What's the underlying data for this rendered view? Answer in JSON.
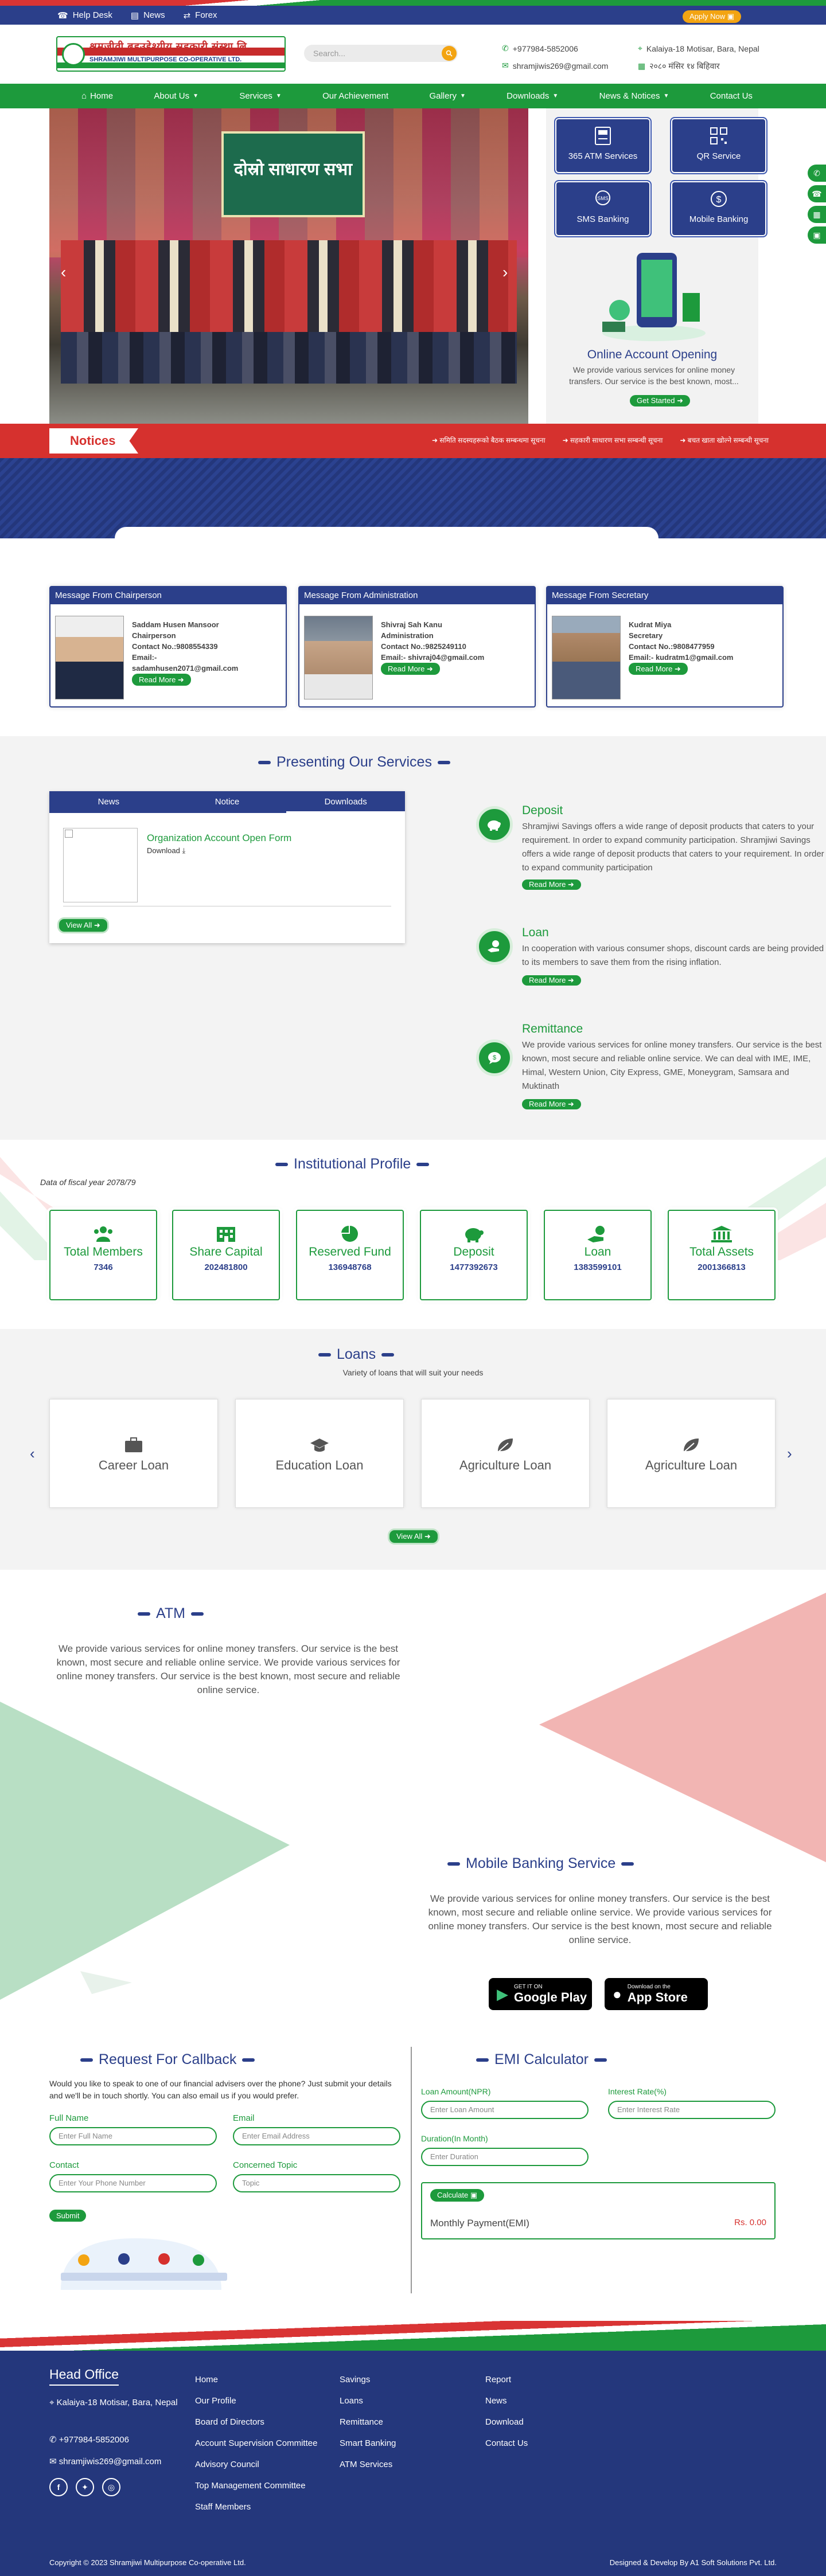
{
  "topbar": {
    "links": [
      "Help Desk",
      "News",
      "Forex"
    ],
    "apply": "Apply Now"
  },
  "header": {
    "logo_name": "श्रमजीवी बहुउद्देश्यीय सहकारी संस्था लि.",
    "logo_sub": "SHRAMJIWI MULTIPURPOSE CO-OPERATIVE LTD.",
    "search_placeholder": "Search...",
    "phone": "+977984-5852006",
    "address": "Kalaiya-18 Motisar, Bara, Nepal",
    "email": "shramjiwis269@gmail.com",
    "reg": "२०८० मंसिर १४ बिहिवार"
  },
  "nav": [
    {
      "label": "Home"
    },
    {
      "label": "About Us",
      "dd": true
    },
    {
      "label": "Services",
      "dd": true
    },
    {
      "label": "Our Achievement"
    },
    {
      "label": "Gallery",
      "dd": true
    },
    {
      "label": "Downloads",
      "dd": true
    },
    {
      "label": "News & Notices",
      "dd": true
    },
    {
      "label": "Contact Us"
    }
  ],
  "hero": {
    "banner_text": "दोस्रो साधारण सभा",
    "tiles": [
      "365 ATM Services",
      "QR Service",
      "SMS Banking",
      "Mobile Banking"
    ],
    "promo_title": "Online Account Opening",
    "promo_text": "We provide various services for online money transfers. Our service is the best known, most...",
    "promo_btn": "Get Started"
  },
  "notices": {
    "label": "Notices",
    "items": [
      "समिति सदस्यहरूको बैठक सम्बन्धमा सूचना",
      "सहकारी साधारण सभा सम्बन्धी सूचना",
      "बचत खाता खोल्ने सम्बन्धी सूचना"
    ]
  },
  "messages": [
    {
      "title": "Message From Chairperson",
      "name": "Saddam Husen Mansoor",
      "role": "Chairperson",
      "contact": "Contact No.:9808554339",
      "email_label": "Email:-",
      "email": "sadamhusen2071@gmail.com",
      "btn": "Read More"
    },
    {
      "title": "Message From Administration",
      "name": "Shivraj Sah Kanu",
      "role": "Administration",
      "contact": "Contact No.:9825249110",
      "email_label": "Email:- shivraj04@gmail.com",
      "email": "",
      "btn": "Read More"
    },
    {
      "title": "Message From Secretary",
      "name": "Kudrat Miya",
      "role": "Secretary",
      "contact": "Contact No.:9808477959",
      "email_label": "Email:- kudratm1@gmail.com",
      "email": "",
      "btn": "Read More"
    }
  ],
  "services": {
    "title": "Presenting Our Services",
    "tabs": [
      "News",
      "Notice",
      "Downloads"
    ],
    "download_title": "Organization Account Open Form",
    "download_label": "Download",
    "view_all": "View All",
    "items": [
      {
        "title": "Deposit",
        "text": "Shramjiwi Savings offers a wide range of deposit products that caters to your requirement. In order to expand community participation. Shramjiwi Savings offers a wide range of deposit products that caters to your requirement. In order to expand community participation",
        "btn": "Read More"
      },
      {
        "title": "Loan",
        "text": "In cooperation with various consumer shops, discount cards are being provided to its members to save them from the rising inflation.",
        "btn": "Read More"
      },
      {
        "title": "Remittance",
        "text": "We provide various services for online money transfers. Our service is the best known, most secure and reliable online service. We can deal with IME, IME, Himal, Western Union, City Express, GME, Moneygram, Samsara and Muktinath",
        "btn": "Read More"
      }
    ]
  },
  "profile": {
    "title": "Institutional Profile",
    "fiscal": "Data of fiscal year 2078/79",
    "stats": [
      {
        "label": "Total Members",
        "value": "7346",
        "icon": "users-icon"
      },
      {
        "label": "Share Capital",
        "value": "202481800",
        "icon": "building-icon"
      },
      {
        "label": "Reserved Fund",
        "value": "136948768",
        "icon": "pie-chart-icon"
      },
      {
        "label": "Deposit",
        "value": "1477392673",
        "icon": "piggy-bank-icon"
      },
      {
        "label": "Loan",
        "value": "1383599101",
        "icon": "hand-holding-usd-icon"
      },
      {
        "label": "Total Assets",
        "value": "2001366813",
        "icon": "bank-icon"
      }
    ]
  },
  "loans": {
    "title": "Loans",
    "subtitle": "Variety of loans that will suit your needs",
    "items": [
      "Career Loan",
      "Education Loan",
      "Agriculture Loan",
      "Agriculture Loan"
    ],
    "view_all": "View All"
  },
  "atm": {
    "title": "ATM",
    "text": "We provide various services for online money transfers. Our service is the best known, most secure and reliable online service. We provide various services for online money transfers. Our service is the best known, most secure and reliable online service."
  },
  "mobile": {
    "title": "Mobile Banking Service",
    "text": "We provide various services for online money transfers. Our service is the best known, most secure and reliable online service. We provide various services for online money transfers. Our service is the best known, most secure and reliable online service.",
    "gp_small": "GET IT ON",
    "gp": "Google Play",
    "as_small": "Download on the",
    "as": "App Store"
  },
  "callback": {
    "title": "Request For Callback",
    "text": "Would you like to speak to one of our financial advisers over the phone? Just submit your details and we'll be in touch shortly. You can also email us if you would prefer.",
    "name_label": "Full Name",
    "name_ph": "Enter Full Name",
    "email_label": "Email",
    "email_ph": "Enter Email Address",
    "contact_label": "Contact",
    "contact_ph": "Enter Your Phone Number",
    "topic_label": "Concerned Topic",
    "topic_ph": "Topic",
    "submit": "Submit"
  },
  "emi": {
    "title": "EMI Calculator",
    "amount_label": "Loan Amount(NPR)",
    "amount_ph": "Enter Loan Amount",
    "rate_label": "Interest Rate(%)",
    "rate_ph": "Enter Interest Rate",
    "duration_label": "Duration(In Month)",
    "duration_ph": "Enter Duration",
    "calc": "Calculate",
    "monthly_label": "Monthly Payment(EMI)",
    "monthly_value": "Rs. 0.00"
  },
  "footer": {
    "head": "Head Office",
    "address": "Kalaiya-18 Motisar, Bara, Nepal",
    "phone": "+977984-5852006",
    "email": "shramjiwis269@gmail.com",
    "col1": [
      "Home",
      "Our Profile",
      "Board of Directors",
      "Account Supervision Committee",
      "Advisory Council",
      "Top Management Committee",
      "Staff Members"
    ],
    "col2": [
      "Savings",
      "Loans",
      "Remittance",
      "Smart Banking",
      "ATM Services"
    ],
    "col3": [
      "Report",
      "News",
      "Download",
      "Contact Us"
    ],
    "copyright": "Copyright © 2023 Shramjiwi Multipurpose Co-operative Ltd.",
    "credit": "Designed & Develop By A1 Soft Solutions Pvt. Ltd."
  },
  "colors": {
    "blue": "#2b3f8a",
    "green": "#1d9a3c",
    "red": "#d6312e",
    "orange": "#f3a412"
  }
}
